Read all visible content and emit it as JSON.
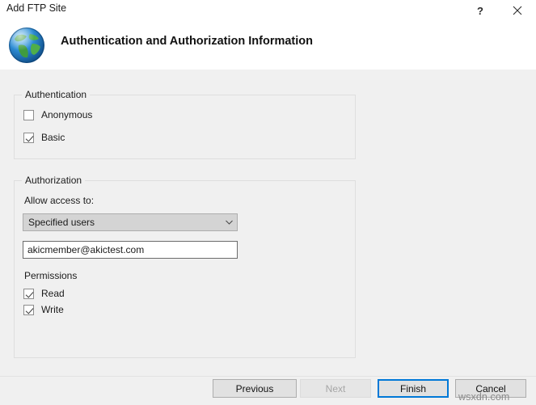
{
  "window": {
    "title": "Add FTP Site",
    "help_label": "?",
    "close_label": "✕",
    "icon": "globe-icon"
  },
  "header": {
    "title": "Authentication and Authorization Information"
  },
  "authentication": {
    "legend": "Authentication",
    "options": [
      {
        "label": "Anonymous",
        "checked": false
      },
      {
        "label": "Basic",
        "checked": true
      }
    ]
  },
  "authorization": {
    "legend": "Authorization",
    "allow_access_label": "Allow access to:",
    "access_select": {
      "value": "Specified users",
      "arrow": "chevron-down-icon"
    },
    "users_field": {
      "value": "akicmember@akictest.com",
      "placeholder": ""
    },
    "permissions": {
      "legend": "Permissions",
      "options": [
        {
          "label": "Read",
          "checked": true
        },
        {
          "label": "Write",
          "checked": true
        }
      ]
    }
  },
  "footer": {
    "previous_label": "Previous",
    "next_label": "Next",
    "finish_label": "Finish",
    "cancel_label": "Cancel"
  },
  "watermark": {
    "text": "wsxdn.com"
  },
  "colors": {
    "accent": "#0078d7",
    "window_bg": "#f0f0f0",
    "header_bg": "#ffffff",
    "group_border": "#dedede",
    "disabled_text": "#a6a6a6"
  }
}
